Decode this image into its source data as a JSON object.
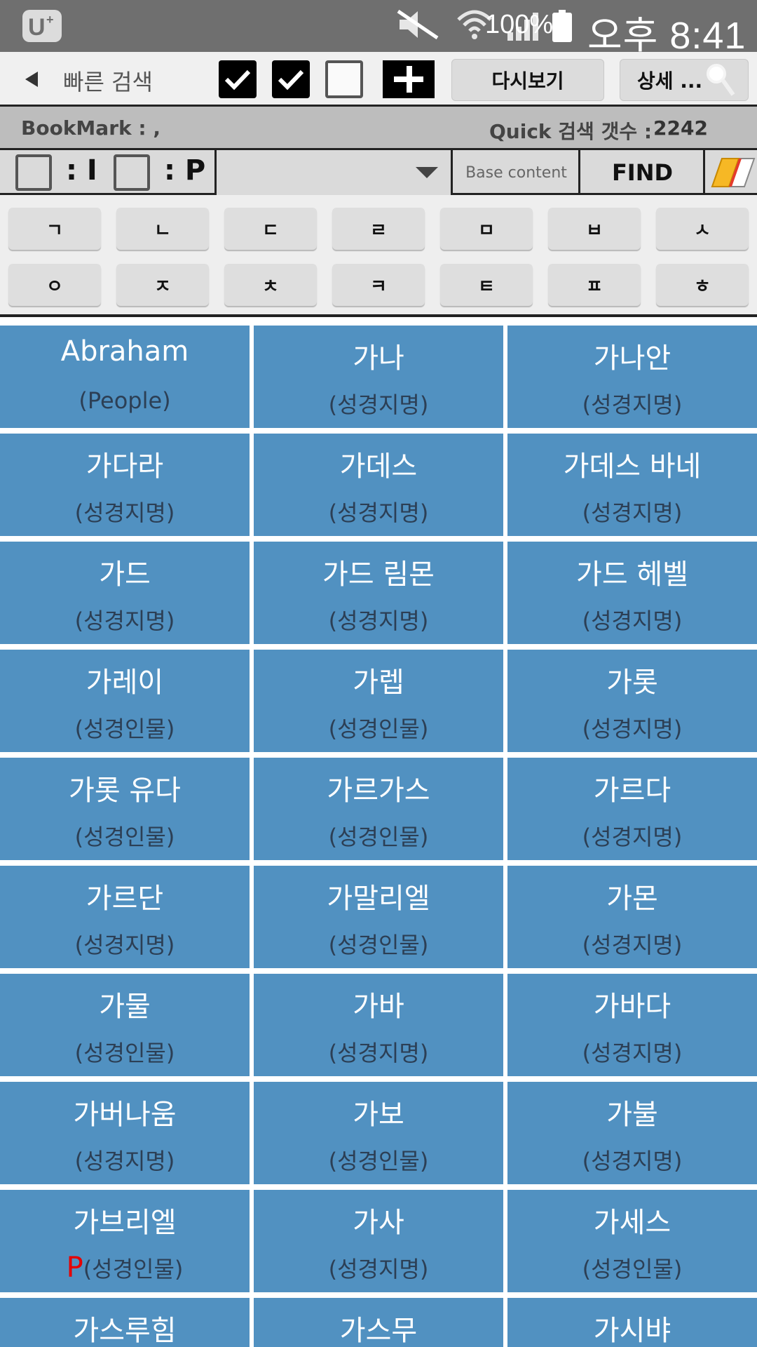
{
  "status_bar": {
    "battery": "100%",
    "time": "오후 8:41",
    "icons": [
      "app-logo-icon",
      "mute-icon",
      "wifi-icon",
      "signal-icon",
      "battery-icon"
    ]
  },
  "toolbar": {
    "title": "빠른 검색",
    "checkboxes": [
      true,
      true,
      false
    ],
    "replay_label": "다시보기",
    "detail_label": "상세 ..."
  },
  "bookmark": {
    "label": "BookMark : ,",
    "quick_label": "Quick 검색 갯수 :",
    "quick_count": "2242"
  },
  "filter": {
    "i_label": ": I",
    "p_label": ": P",
    "base_content": "Base content",
    "find_label": "FIND"
  },
  "consonants": [
    "ㄱ",
    "ㄴ",
    "ㄷ",
    "ㄹ",
    "ㅁ",
    "ㅂ",
    "ㅅ",
    "ㅇ",
    "ㅈ",
    "ㅊ",
    "ㅋ",
    "ㅌ",
    "ㅍ",
    "ㅎ"
  ],
  "entries": [
    {
      "name": "Abraham",
      "category": "(People)",
      "marker": ""
    },
    {
      "name": "가나",
      "category": "(성경지명)",
      "marker": ""
    },
    {
      "name": "가나안",
      "category": "(성경지명)",
      "marker": ""
    },
    {
      "name": "가다라",
      "category": "(성경지명)",
      "marker": ""
    },
    {
      "name": "가데스",
      "category": "(성경지명)",
      "marker": ""
    },
    {
      "name": "가데스 바네",
      "category": "(성경지명)",
      "marker": ""
    },
    {
      "name": "가드",
      "category": "(성경지명)",
      "marker": ""
    },
    {
      "name": "가드 림몬",
      "category": "(성경지명)",
      "marker": ""
    },
    {
      "name": "가드 헤벨",
      "category": "(성경지명)",
      "marker": ""
    },
    {
      "name": "가레이",
      "category": "(성경인물)",
      "marker": ""
    },
    {
      "name": "가렙",
      "category": "(성경인물)",
      "marker": ""
    },
    {
      "name": "가롯",
      "category": "(성경지명)",
      "marker": ""
    },
    {
      "name": "가롯 유다",
      "category": "(성경인물)",
      "marker": ""
    },
    {
      "name": "가르가스",
      "category": "(성경인물)",
      "marker": ""
    },
    {
      "name": "가르다",
      "category": "(성경지명)",
      "marker": ""
    },
    {
      "name": "가르단",
      "category": "(성경지명)",
      "marker": ""
    },
    {
      "name": "가말리엘",
      "category": "(성경인물)",
      "marker": ""
    },
    {
      "name": "가몬",
      "category": "(성경지명)",
      "marker": ""
    },
    {
      "name": "가물",
      "category": "(성경인물)",
      "marker": ""
    },
    {
      "name": "가바",
      "category": "(성경지명)",
      "marker": ""
    },
    {
      "name": "가바다",
      "category": "(성경지명)",
      "marker": ""
    },
    {
      "name": "가버나움",
      "category": "(성경지명)",
      "marker": ""
    },
    {
      "name": "가보",
      "category": "(성경인물)",
      "marker": ""
    },
    {
      "name": "가불",
      "category": "(성경지명)",
      "marker": ""
    },
    {
      "name": "가브리엘",
      "category": "(성경인물)",
      "marker": "P"
    },
    {
      "name": "가사",
      "category": "(성경지명)",
      "marker": ""
    },
    {
      "name": "가세스",
      "category": "(성경인물)",
      "marker": ""
    },
    {
      "name": "가스루힘",
      "category": "",
      "marker": ""
    },
    {
      "name": "가스무",
      "category": "",
      "marker": ""
    },
    {
      "name": "가시뱌",
      "category": "",
      "marker": ""
    }
  ]
}
